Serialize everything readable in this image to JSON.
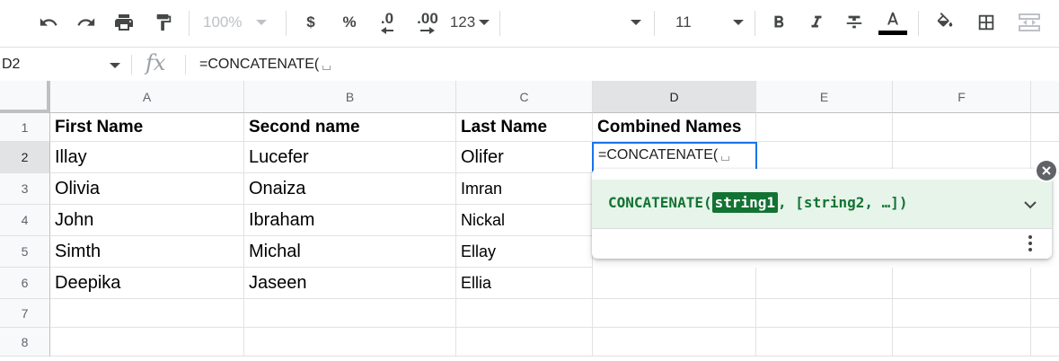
{
  "toolbar": {
    "zoom": "100%",
    "currency": "$",
    "percent": "%",
    "decrease_decimal": ".0",
    "increase_decimal": ".00",
    "more_formats": "123",
    "font_size": "11",
    "icons": [
      "undo-icon",
      "redo-icon",
      "print-icon",
      "paint-format-icon",
      "bold-icon",
      "italic-icon",
      "strikethrough-icon",
      "text-color-icon",
      "fill-color-icon",
      "borders-icon",
      "merge-cells-icon"
    ],
    "text_color_value": "#000000"
  },
  "formula_bar": {
    "name_box": "D2",
    "fx_label": "fx",
    "formula": "=CONCATENATE("
  },
  "columns": [
    "A",
    "B",
    "C",
    "D",
    "E",
    "F"
  ],
  "active_column": "D",
  "rows": [
    "1",
    "2",
    "3",
    "4",
    "5",
    "6",
    "7",
    "8"
  ],
  "active_row": "2",
  "cells": {
    "r1": [
      "First Name",
      "Second name",
      "Last Name",
      "Combined Names"
    ],
    "r2": [
      "Illay",
      "Lucefer",
      "Olifer"
    ],
    "r3": [
      "Olivia",
      "Onaiza",
      "Imran"
    ],
    "r4": [
      "John",
      "Ibraham",
      "Nickal"
    ],
    "r5": [
      "Simth",
      "Michal",
      "Ellay"
    ],
    "r6": [
      "Deepika",
      "Jaseen",
      "Ellia"
    ]
  },
  "active_cell": {
    "ref": "D2",
    "content": "=CONCATENATE("
  },
  "formula_help": {
    "func_open": "CONCATENATE(",
    "arg_highlight": "string1",
    "rest": ", [string2, …])",
    "colors": {
      "bg": "#e6f4ea",
      "accent": "#137333"
    }
  },
  "colors": {
    "selection": "#1a73e8",
    "header_bg": "#f8f9fa",
    "header_active_bg": "#e1e3e5"
  }
}
